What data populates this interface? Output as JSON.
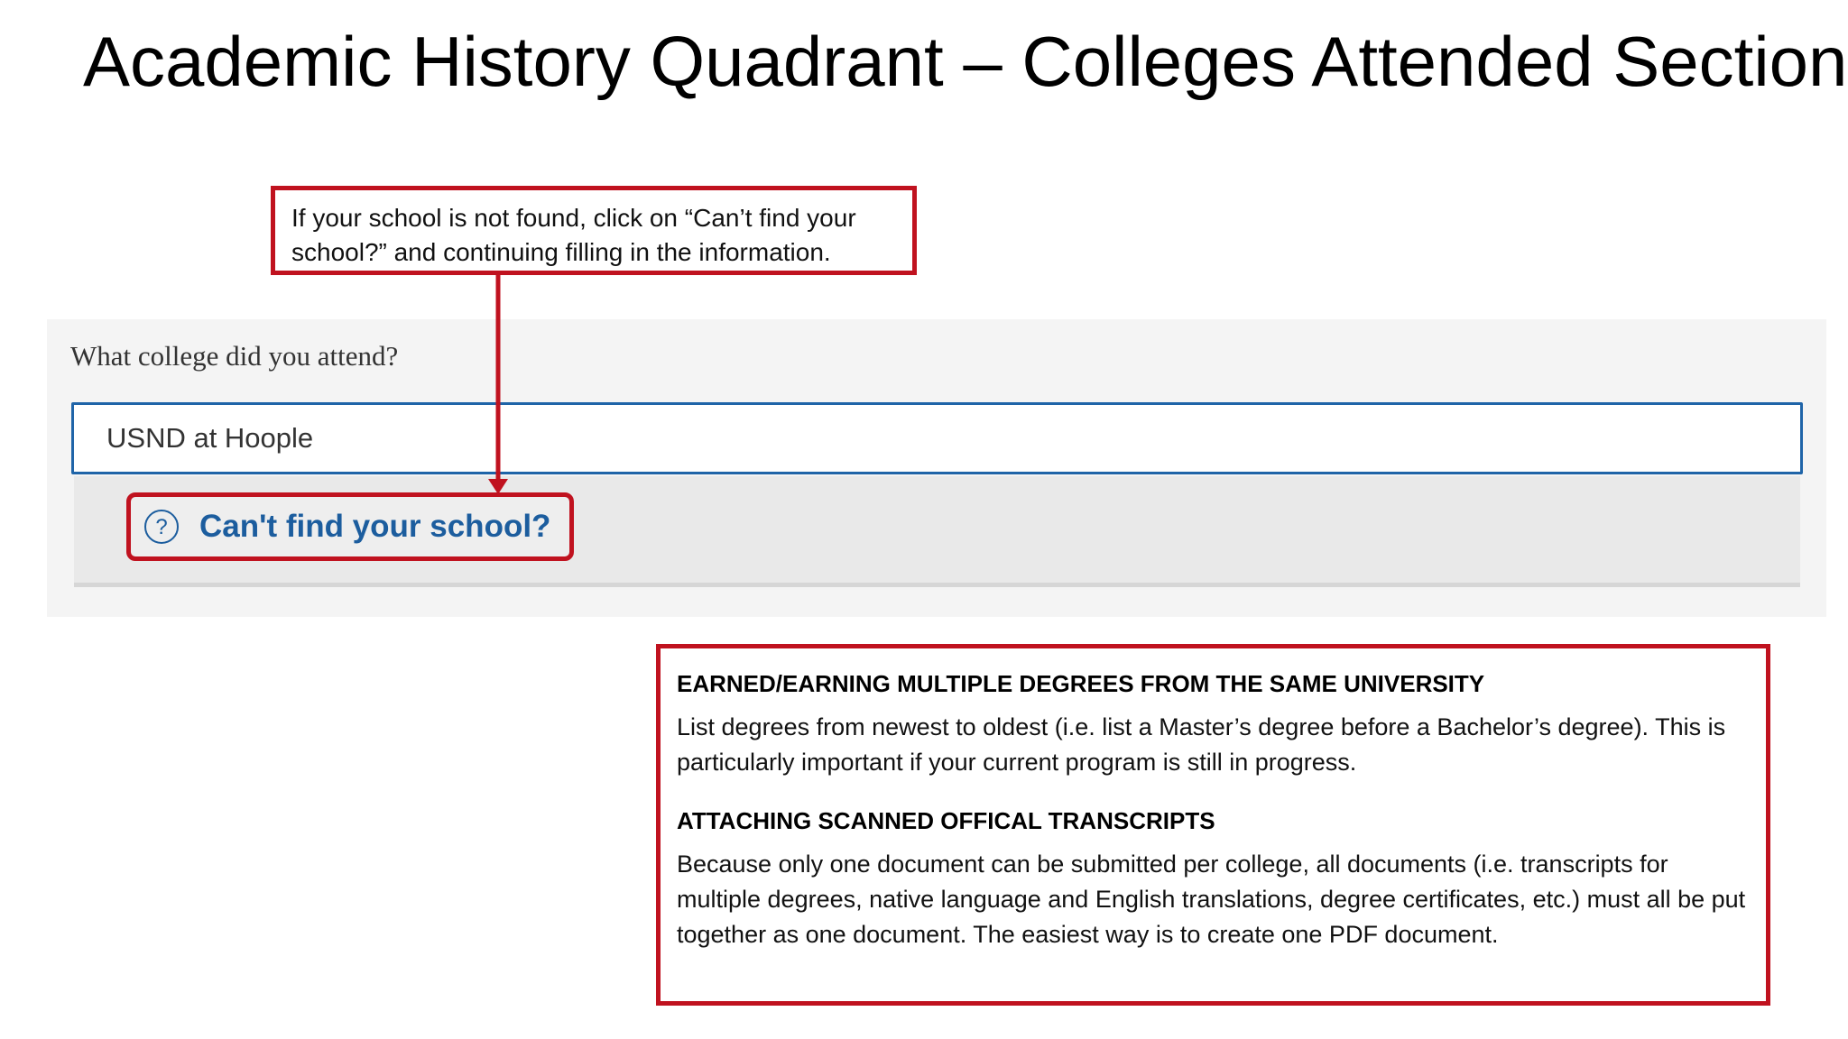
{
  "slide": {
    "title": "Academic History Quadrant – Colleges Attended Section"
  },
  "callout_top": {
    "text": "If your school is not found, click on “Can’t find your school?” and continuing filling in the information."
  },
  "form": {
    "question_label": "What college did you attend?",
    "college_input_value": "USND at Hoople",
    "cant_find_link_label": "Can't find your school?"
  },
  "info_box": {
    "section1_heading": "EARNED/EARNING MULTIPLE DEGREES FROM THE SAME UNIVERSITY",
    "section1_text": "List degrees from newest to oldest (i.e. list a Master’s degree before a Bachelor’s degree). This is particularly important if your current program is still in progress.",
    "section2_heading": "ATTACHING SCANNED OFFICAL TRANSCRIPTS",
    "section2_text": "Because only one document can be submitted per college, all documents (i.e. transcripts for multiple degrees, native language and English translations, degree certificates, etc.) must all be put together as one document. The easiest way is to create one PDF document."
  },
  "colors": {
    "callout_border": "#c0121f",
    "input_border": "#1f64a8",
    "link_text": "#1c5d9e",
    "panel_background": "#f4f4f4",
    "dropdown_background": "#e9e9e9"
  },
  "icons": {
    "help": "question-circle-icon",
    "pointer": "arrow-down-icon"
  }
}
